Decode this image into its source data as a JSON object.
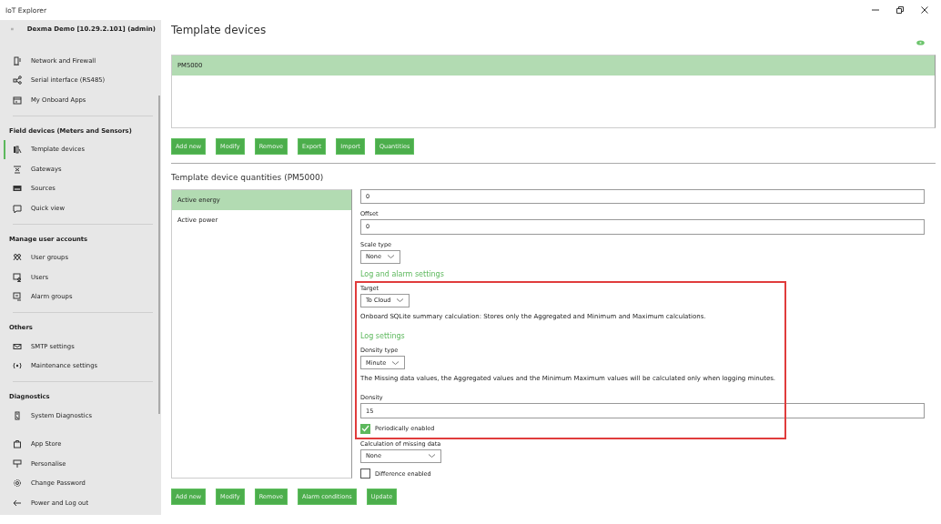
{
  "window": {
    "title": "IoT Explorer"
  },
  "sidebar": {
    "header": "Dexma Demo [10.29.2.101] (admin)",
    "sections": [
      {
        "items": [
          {
            "label": "Network and Firewall",
            "selected": false
          },
          {
            "label": "Serial interface (RS485)",
            "selected": false
          },
          {
            "label": "My Onboard Apps",
            "selected": false
          }
        ]
      },
      {
        "title": "Field devices (Meters and Sensors)",
        "items": [
          {
            "label": "Template devices",
            "selected": true
          },
          {
            "label": "Gateways",
            "selected": false
          },
          {
            "label": "Sources",
            "selected": false
          },
          {
            "label": "Quick view",
            "selected": false
          }
        ]
      },
      {
        "title": "Manage user accounts",
        "items": [
          {
            "label": "User groups",
            "selected": false
          },
          {
            "label": "Users",
            "selected": false
          },
          {
            "label": "Alarm groups",
            "selected": false
          }
        ]
      },
      {
        "title": "Others",
        "items": [
          {
            "label": "SMTP settings",
            "selected": false
          },
          {
            "label": "Maintenance settings",
            "selected": false
          }
        ]
      },
      {
        "title": "Diagnostics",
        "items": [
          {
            "label": "System Diagnostics",
            "selected": false
          }
        ]
      },
      {
        "items": [
          {
            "label": "App Store",
            "selected": false
          },
          {
            "label": "Personalise",
            "selected": false
          },
          {
            "label": "Change Password",
            "selected": false
          },
          {
            "label": "Power and Log out",
            "selected": false
          }
        ]
      }
    ]
  },
  "page": {
    "title": "Template devices",
    "devices": [
      {
        "name": "PM5000",
        "selected": true
      }
    ],
    "device_buttons": [
      "Add new",
      "Modify",
      "Remove",
      "Export",
      "Import",
      "Quantities"
    ],
    "quantities_title": "Template device quantities (PM5000)",
    "quantities": [
      {
        "name": "Active energy",
        "selected": true
      },
      {
        "name": "Active power",
        "selected": false
      }
    ],
    "form": [
      {
        "kind": "field",
        "value": "0"
      },
      {
        "kind": "label",
        "text": "Offset"
      },
      {
        "kind": "field",
        "value": "0"
      },
      {
        "kind": "label",
        "text": "Scale type"
      },
      {
        "kind": "dropdown",
        "value": "None"
      },
      {
        "kind": "heading",
        "text": "Log and alarm settings"
      },
      {
        "kind": "label",
        "text": "Target"
      },
      {
        "kind": "dropdown",
        "value": "To Cloud"
      },
      {
        "kind": "note",
        "text": "Onboard SQLite summary calculation: Stores only the Aggregated and Minimum and Maximum calculations."
      },
      {
        "kind": "heading",
        "text": "Log settings"
      },
      {
        "kind": "label",
        "text": "Density type"
      },
      {
        "kind": "dropdown",
        "value": "Minute"
      },
      {
        "kind": "note",
        "text": "The Missing data values, the Aggregated values and the Minimum Maximum values will be calculated only when logging minutes."
      },
      {
        "kind": "label",
        "text": "Density"
      },
      {
        "kind": "field",
        "value": "15"
      },
      {
        "kind": "checkbox",
        "label": "Periodically enabled",
        "checked": true
      },
      {
        "kind": "label",
        "text": "Calculation of missing data"
      },
      {
        "kind": "dropdown",
        "value": "None",
        "wide": true
      },
      {
        "kind": "checkbox",
        "label": "Difference enabled",
        "checked": false
      }
    ],
    "quantity_buttons": [
      "Add new",
      "Modify",
      "Remove",
      "Alarm conditions",
      "Update"
    ]
  }
}
